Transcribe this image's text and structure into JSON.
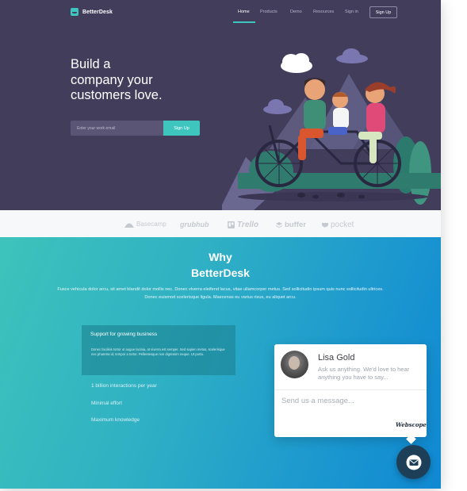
{
  "nav": {
    "brand": "BetterDesk",
    "links": [
      {
        "label": "Home",
        "active": true
      },
      {
        "label": "Products",
        "active": false
      },
      {
        "label": "Demo",
        "active": false
      },
      {
        "label": "Resources",
        "active": false
      },
      {
        "label": "Sign in",
        "active": false
      }
    ],
    "signup_label": "Sign Up"
  },
  "hero": {
    "headline_lines": [
      "Build a",
      "company your",
      "customers love."
    ],
    "email_placeholder": "Enter your work email",
    "submit_label": "Sign Up"
  },
  "logos": {
    "brands": [
      {
        "label": "Basecamp",
        "icon": "basecamp-icon"
      },
      {
        "label": "grubhub",
        "icon": ""
      },
      {
        "label": "Trello",
        "icon": "trello-icon"
      },
      {
        "label": "buffer",
        "icon": "buffer-icon"
      },
      {
        "label": "pocket",
        "icon": "pocket-icon"
      }
    ]
  },
  "features": {
    "title_line1": "Why",
    "title_line2": "BetterDesk",
    "intro": "Fusce vehicula dolor arcu, sit amet blandit dolor mollis nec. Donec viverra eleifend lacus, vitae ullamcorper metus. Sed sollicitudin ipsum quis nunc sollicitudin ultrices. Donec euismod scelerisque ligula. Maecenas eu varius risus, eu aliquet arcu.",
    "card_title": "Support for growing business",
    "card_desc": "Donec facilisis tortor ut augue lacinia, at viverra est semper. Sed sapien metus, scelerisque nec pharetra id, tempor a tortor. Pellentesque non dignissim neque. Ut porta.",
    "items": [
      "1 billion interactions per year",
      "Minimal effort",
      "Maximum knowledge"
    ]
  },
  "chat": {
    "agent_name": "Lisa Gold",
    "agent_message": "Ask us anything. We'd love to hear anything you have to say...",
    "input_placeholder": "Send us a message...",
    "brand": "Webscope"
  },
  "colors": {
    "hero_bg": "#433d5c",
    "accent": "#3ec6be",
    "gradient_start": "#3ec3bb",
    "gradient_end": "#0f88d2",
    "fab": "#1d3f57"
  }
}
